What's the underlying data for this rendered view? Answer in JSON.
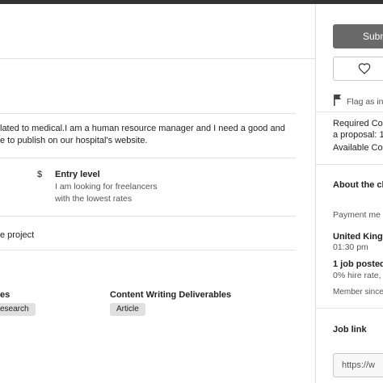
{
  "description": {
    "line1": "lated to medical.I am a human resource manager and I need a good and",
    "line2": "e to publish on our hospital's website."
  },
  "experience": {
    "icon_symbol": "$",
    "level": "Entry level",
    "note_line1": "I am looking for freelancers",
    "note_line2": "with the lowest rates"
  },
  "project_type": "e project",
  "skills": {
    "left_heading": "es",
    "left_chip": "esearch",
    "right_heading": "Content Writing Deliverables",
    "right_chip": "Article"
  },
  "sidebar": {
    "submit_label": "Submi",
    "flag_label": "Flag as in",
    "connects_line1": "Required Co",
    "connects_line2": "a proposal: 1",
    "available_label": "Available Co",
    "about_client": "About the cl",
    "payment_label": "Payment me",
    "location": "United Kinge",
    "local_time": "01:30 pm",
    "jobs_posted": "1 job posted",
    "hire_rate": "0% hire rate,",
    "member_since": "Member since",
    "job_link_heading": "Job link",
    "job_link_value": "https://w"
  }
}
